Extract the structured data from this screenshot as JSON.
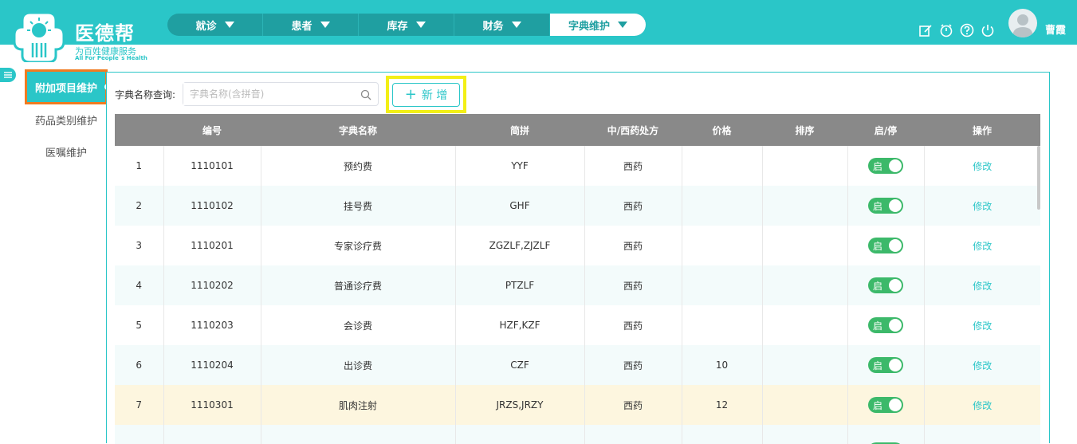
{
  "brand": {
    "name": "医德帮",
    "slogan": "为百姓健康服务",
    "slogan_en": "All For People`s Health"
  },
  "nav": {
    "items": [
      {
        "label": "就诊"
      },
      {
        "label": "患者"
      },
      {
        "label": "库存"
      },
      {
        "label": "财务"
      },
      {
        "label": "字典维护",
        "active": true
      }
    ]
  },
  "header": {
    "icons": [
      "edit-icon",
      "timer-icon",
      "help-icon",
      "power-icon"
    ],
    "user_name": "曹霞"
  },
  "sidebar": {
    "items": [
      {
        "label": "附加项目维护",
        "active": true
      },
      {
        "label": "药品类别维护"
      },
      {
        "label": "医嘱维护"
      }
    ]
  },
  "toolbar": {
    "search_label": "字典名称查询:",
    "search_placeholder": "字典名称(含拼音)",
    "add_label": "新 增"
  },
  "table": {
    "headers": [
      "",
      "编号",
      "字典名称",
      "简拼",
      "中/西药处方",
      "价格",
      "排序",
      "启/停",
      "操作"
    ],
    "rows": [
      {
        "idx": "1",
        "code": "1110101",
        "name": "预约费",
        "abbr": "YYF",
        "type": "西药",
        "price": "",
        "sort": "",
        "status": "启",
        "action": "修改"
      },
      {
        "idx": "2",
        "code": "1110102",
        "name": "挂号费",
        "abbr": "GHF",
        "type": "西药",
        "price": "",
        "sort": "",
        "status": "启",
        "action": "修改"
      },
      {
        "idx": "3",
        "code": "1110201",
        "name": "专家诊疗费",
        "abbr": "ZGZLF,ZJZLF",
        "type": "西药",
        "price": "",
        "sort": "",
        "status": "启",
        "action": "修改"
      },
      {
        "idx": "4",
        "code": "1110202",
        "name": "普通诊疗费",
        "abbr": "PTZLF",
        "type": "西药",
        "price": "",
        "sort": "",
        "status": "启",
        "action": "修改"
      },
      {
        "idx": "5",
        "code": "1110203",
        "name": "会诊费",
        "abbr": "HZF,KZF",
        "type": "西药",
        "price": "",
        "sort": "",
        "status": "启",
        "action": "修改"
      },
      {
        "idx": "6",
        "code": "1110204",
        "name": "出诊费",
        "abbr": "CZF",
        "type": "西药",
        "price": "10",
        "sort": "",
        "status": "启",
        "action": "修改"
      },
      {
        "idx": "7",
        "code": "1110301",
        "name": "肌肉注射",
        "abbr": "JRZS,JRZY",
        "type": "西药",
        "price": "12",
        "sort": "",
        "status": "启",
        "action": "修改"
      },
      {
        "idx": "",
        "code": "",
        "name": "",
        "abbr": "",
        "type": "",
        "price": "",
        "sort": "",
        "status": "",
        "action": ""
      }
    ]
  },
  "colors": {
    "brand": "#2ac6c8",
    "nav_bg": "#1f9fa1",
    "header_row": "#898989",
    "switch_on": "#3cb96a",
    "highlight_row": "#fdf6df",
    "sidebar_highlight_border": "#f07b21",
    "add_highlight_border": "#f3ef16"
  }
}
